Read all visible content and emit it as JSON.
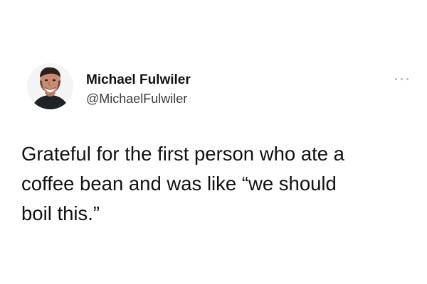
{
  "tweet": {
    "author": {
      "display_name": "Michael Fulwiler",
      "handle": "@MichaelFulwiler"
    },
    "text": "Grateful for the first person who ate a\ncoffee bean and was like “we should\nboil this.”",
    "more_icon": "more-options-icon"
  },
  "colors": {
    "text": "#111111",
    "secondary_text": "#3a3a3a",
    "background": "#ffffff"
  }
}
